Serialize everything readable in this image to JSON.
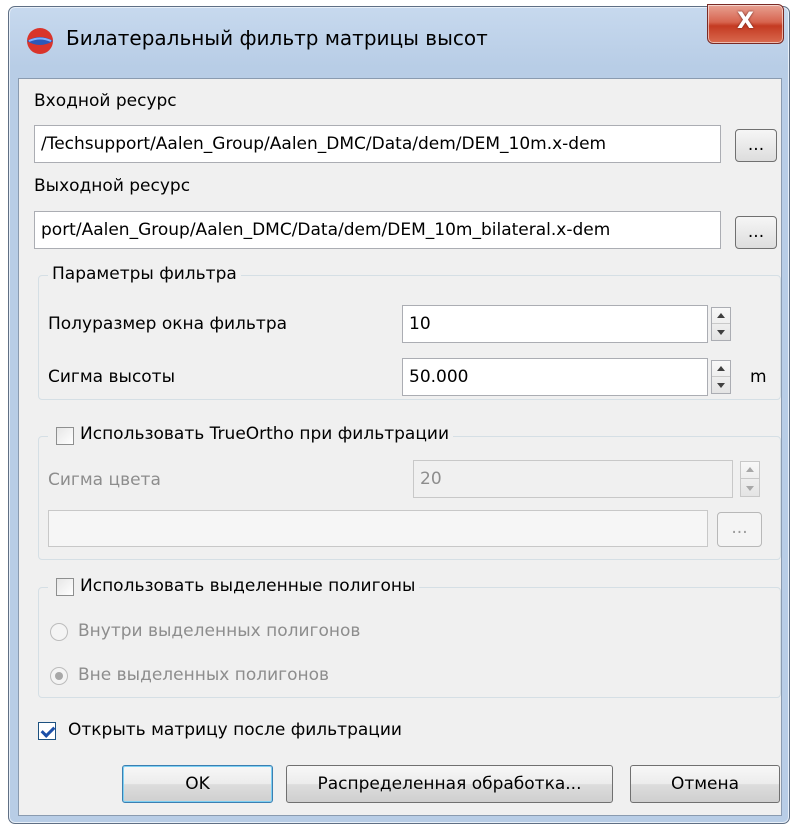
{
  "window": {
    "title": "Билатеральный фильтр матрицы высот",
    "close_label": "X",
    "icon": "app-globe-icon"
  },
  "input_resource": {
    "label": "Входной ресурс",
    "value": "/Techsupport/Aalen_Group/Aalen_DMC/Data/dem/DEM_10m.x-dem",
    "browse_label": "..."
  },
  "output_resource": {
    "label": "Выходной ресурс",
    "value": "port/Aalen_Group/Aalen_DMC/Data/dem/DEM_10m_bilateral.x-dem",
    "browse_label": "..."
  },
  "filter_params": {
    "legend": "Параметры фильтра",
    "half_window_label": "Полуразмер окна фильтра",
    "half_window_value": "10",
    "sigma_height_label": "Сигма высоты",
    "sigma_height_value": "50.000",
    "sigma_height_unit": "m"
  },
  "trueortho": {
    "label": "Использовать TrueOrtho при фильтрации",
    "checked": false,
    "sigma_color_label": "Сигма цвета",
    "sigma_color_value": "20",
    "path_value": "",
    "browse_label": "..."
  },
  "polygons": {
    "label": "Использовать выделенные полигоны",
    "checked": false,
    "inside_label": "Внутри выделенных полигонов",
    "outside_label": "Вне выделенных полигонов",
    "selected": "outside"
  },
  "open_after": {
    "label": "Открыть матрицу после фильтрации",
    "checked": true
  },
  "buttons": {
    "ok": "OK",
    "distributed": "Распределенная обработка...",
    "cancel": "Отмена"
  }
}
